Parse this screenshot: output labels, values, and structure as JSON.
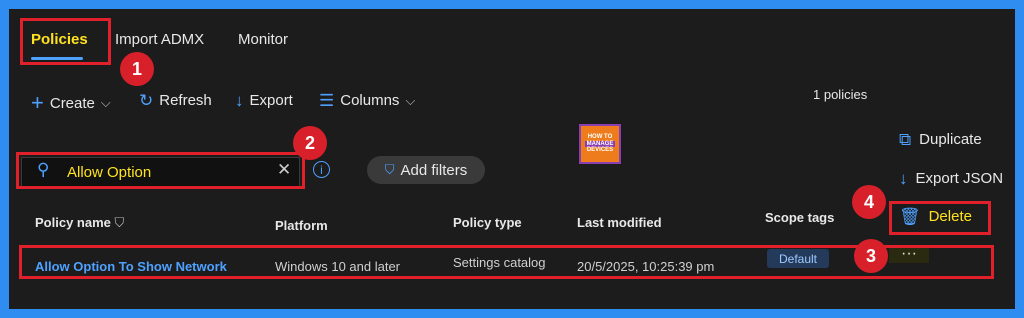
{
  "tabs": [
    "Policies",
    "Import ADMX",
    "Monitor"
  ],
  "toolbar": {
    "create": "Create",
    "refresh": "Refresh",
    "export": "Export",
    "columns": "Columns",
    "count": "1 policies"
  },
  "search": {
    "value": "Allow Option"
  },
  "filters": {
    "add_label": "Add filters"
  },
  "table": {
    "headers": [
      "Policy name",
      "Platform",
      "Policy type",
      "Last modified",
      "Scope tags"
    ],
    "row": {
      "name": "Allow Option To Show Network",
      "platform": "Windows 10 and later",
      "type": "Settings catalog",
      "modified": "20/5/2025, 10:25:39 pm",
      "scope": "Default",
      "more": "···"
    }
  },
  "context_menu": {
    "duplicate": "Duplicate",
    "export_json": "Export JSON",
    "delete": "Delete"
  },
  "steps": [
    "1",
    "2",
    "3",
    "4"
  ],
  "logo": {
    "line1": "HOW TO",
    "line2": "MANAGE",
    "line3": "DEVICES"
  },
  "colors": {
    "accent": "#4ea1ff",
    "highlight": "#ffe21f",
    "annotation": "#e0202a",
    "frame": "#2f8cf0"
  }
}
